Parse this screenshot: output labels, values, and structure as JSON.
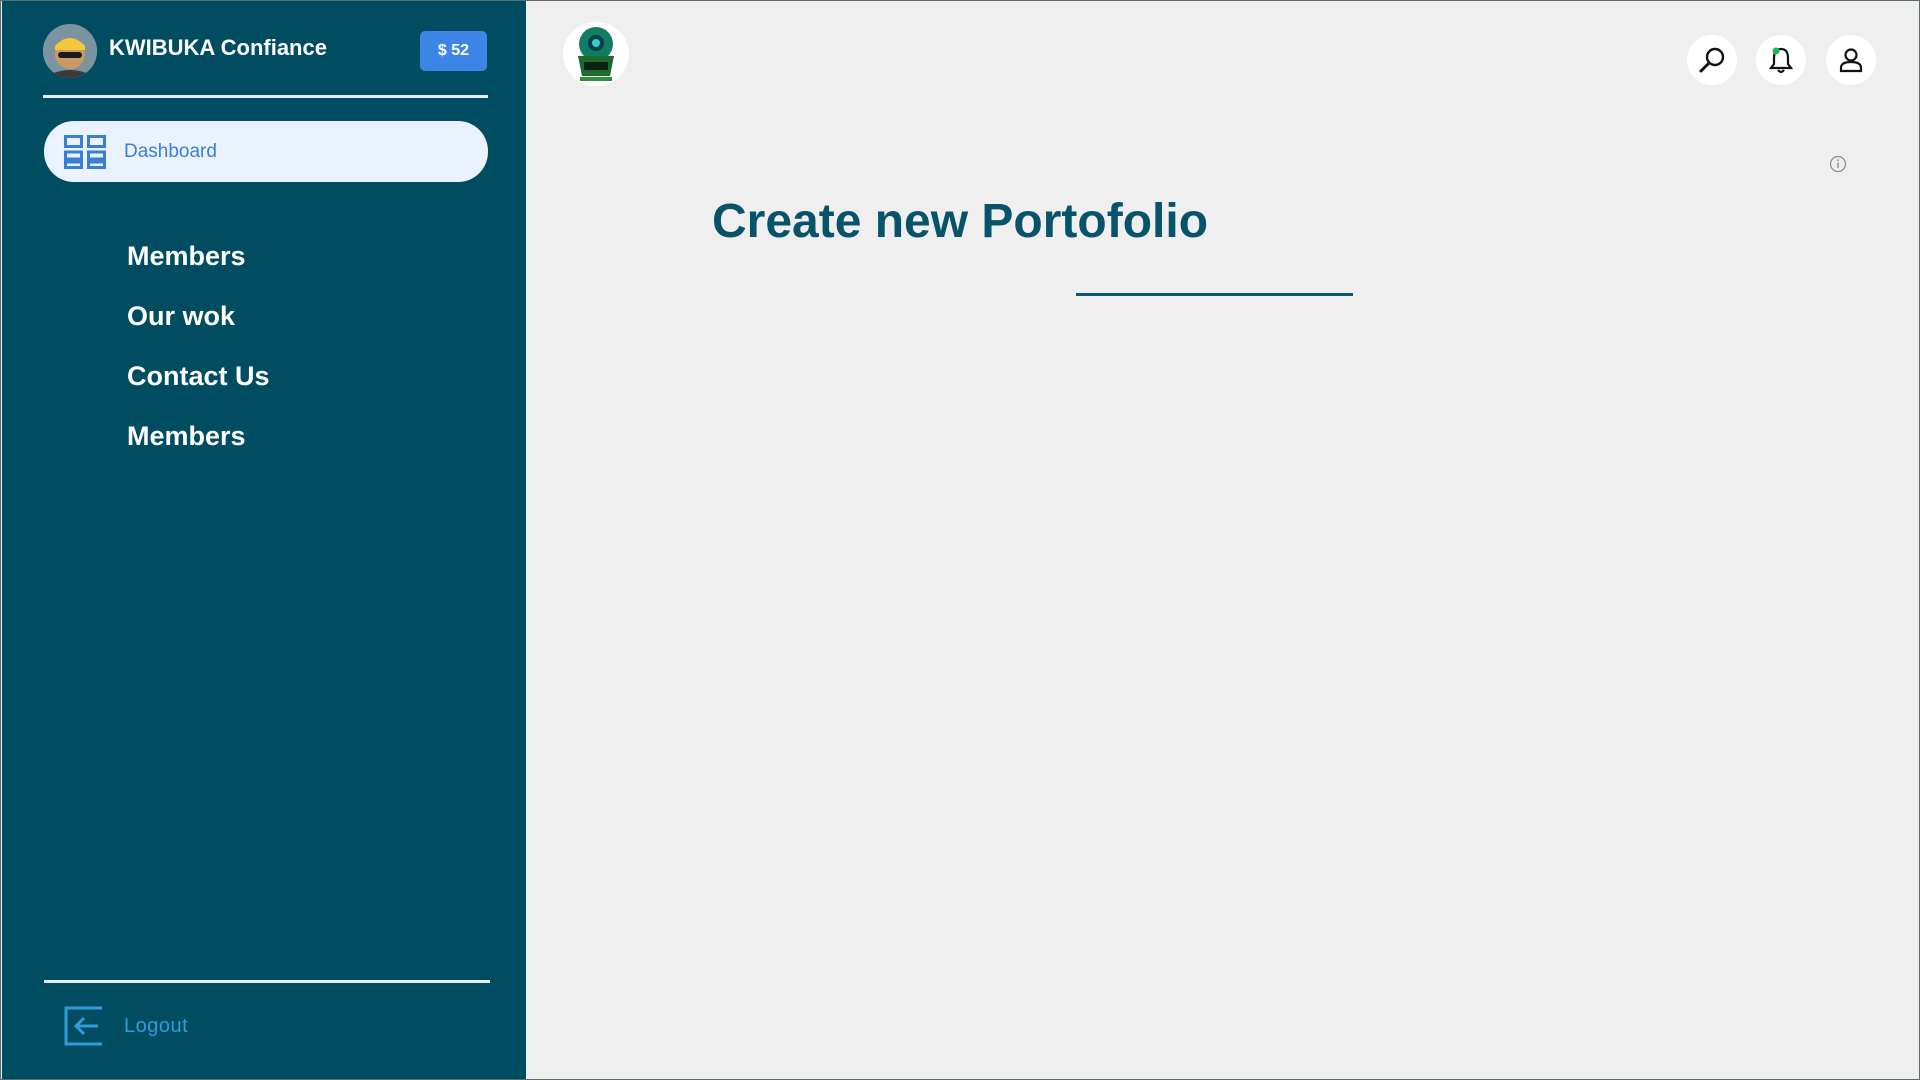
{
  "sidebar": {
    "user_name": "KWIBUKA Confiance",
    "balance": "$ 52",
    "dashboard_label": "Dashboard",
    "nav_items": [
      {
        "label": "Members"
      },
      {
        "label": "Our wok"
      },
      {
        "label": "Contact Us"
      },
      {
        "label": "Members"
      }
    ],
    "logout_label": "Logout"
  },
  "header": {
    "icons": [
      "search-icon",
      "bell-icon",
      "user-icon"
    ]
  },
  "main": {
    "title": "Create new Portofolio"
  },
  "colors": {
    "sidebar_bg": "#004d62",
    "accent_blue": "#3d86e8",
    "title": "#07536a",
    "page_bg": "#efefef"
  }
}
